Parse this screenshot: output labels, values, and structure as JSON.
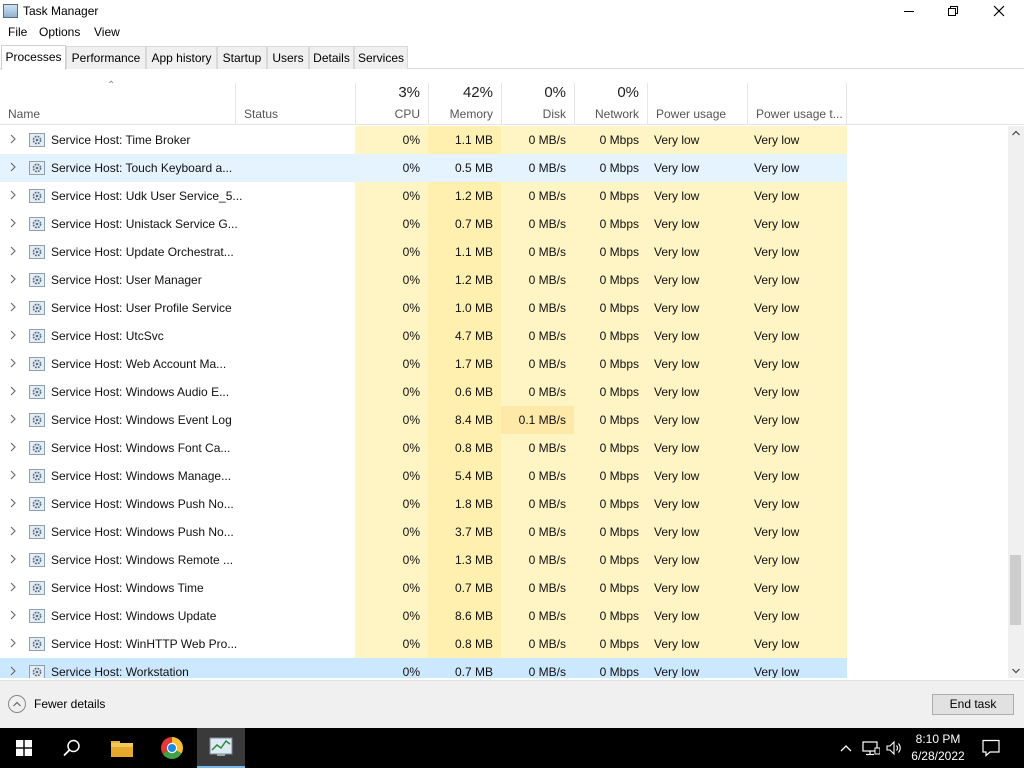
{
  "window": {
    "title": "Task Manager"
  },
  "menu": [
    "File",
    "Options",
    "View"
  ],
  "tabs": [
    "Processes",
    "Performance",
    "App history",
    "Startup",
    "Users",
    "Details",
    "Services"
  ],
  "columns": {
    "name": "Name",
    "status": "Status",
    "cpu": {
      "pct": "3%",
      "label": "CPU"
    },
    "memory": {
      "pct": "42%",
      "label": "Memory"
    },
    "disk": {
      "pct": "0%",
      "label": "Disk"
    },
    "network": {
      "pct": "0%",
      "label": "Network"
    },
    "power": "Power usage",
    "power_trend": "Power usage t..."
  },
  "processes": [
    {
      "name": "Service Host: Time Broker",
      "cpu": "0%",
      "memory": "1.1 MB",
      "disk": "0 MB/s",
      "network": "0 Mbps",
      "power": "Very low",
      "power_trend": "Very low"
    },
    {
      "name": "Service Host: Touch Keyboard a...",
      "cpu": "0%",
      "memory": "0.5 MB",
      "disk": "0 MB/s",
      "network": "0 Mbps",
      "power": "Very low",
      "power_trend": "Very low"
    },
    {
      "name": "Service Host: Udk User Service_5...",
      "cpu": "0%",
      "memory": "1.2 MB",
      "disk": "0 MB/s",
      "network": "0 Mbps",
      "power": "Very low",
      "power_trend": "Very low"
    },
    {
      "name": "Service Host: Unistack Service G...",
      "cpu": "0%",
      "memory": "0.7 MB",
      "disk": "0 MB/s",
      "network": "0 Mbps",
      "power": "Very low",
      "power_trend": "Very low"
    },
    {
      "name": "Service Host: Update Orchestrat...",
      "cpu": "0%",
      "memory": "1.1 MB",
      "disk": "0 MB/s",
      "network": "0 Mbps",
      "power": "Very low",
      "power_trend": "Very low"
    },
    {
      "name": "Service Host: User Manager",
      "cpu": "0%",
      "memory": "1.2 MB",
      "disk": "0 MB/s",
      "network": "0 Mbps",
      "power": "Very low",
      "power_trend": "Very low"
    },
    {
      "name": "Service Host: User Profile Service",
      "cpu": "0%",
      "memory": "1.0 MB",
      "disk": "0 MB/s",
      "network": "0 Mbps",
      "power": "Very low",
      "power_trend": "Very low"
    },
    {
      "name": "Service Host: UtcSvc",
      "cpu": "0%",
      "memory": "4.7 MB",
      "disk": "0 MB/s",
      "network": "0 Mbps",
      "power": "Very low",
      "power_trend": "Very low"
    },
    {
      "name": "Service Host: Web Account Ma...",
      "cpu": "0%",
      "memory": "1.7 MB",
      "disk": "0 MB/s",
      "network": "0 Mbps",
      "power": "Very low",
      "power_trend": "Very low"
    },
    {
      "name": "Service Host: Windows Audio E...",
      "cpu": "0%",
      "memory": "0.6 MB",
      "disk": "0 MB/s",
      "network": "0 Mbps",
      "power": "Very low",
      "power_trend": "Very low"
    },
    {
      "name": "Service Host: Windows Event Log",
      "cpu": "0%",
      "memory": "8.4 MB",
      "disk": "0.1 MB/s",
      "network": "0 Mbps",
      "power": "Very low",
      "power_trend": "Very low"
    },
    {
      "name": "Service Host: Windows Font Ca...",
      "cpu": "0%",
      "memory": "0.8 MB",
      "disk": "0 MB/s",
      "network": "0 Mbps",
      "power": "Very low",
      "power_trend": "Very low"
    },
    {
      "name": "Service Host: Windows Manage...",
      "cpu": "0%",
      "memory": "5.4 MB",
      "disk": "0 MB/s",
      "network": "0 Mbps",
      "power": "Very low",
      "power_trend": "Very low"
    },
    {
      "name": "Service Host: Windows Push No...",
      "cpu": "0%",
      "memory": "1.8 MB",
      "disk": "0 MB/s",
      "network": "0 Mbps",
      "power": "Very low",
      "power_trend": "Very low"
    },
    {
      "name": "Service Host: Windows Push No...",
      "cpu": "0%",
      "memory": "3.7 MB",
      "disk": "0 MB/s",
      "network": "0 Mbps",
      "power": "Very low",
      "power_trend": "Very low"
    },
    {
      "name": "Service Host: Windows Remote ...",
      "cpu": "0%",
      "memory": "1.3 MB",
      "disk": "0 MB/s",
      "network": "0 Mbps",
      "power": "Very low",
      "power_trend": "Very low"
    },
    {
      "name": "Service Host: Windows Time",
      "cpu": "0%",
      "memory": "0.7 MB",
      "disk": "0 MB/s",
      "network": "0 Mbps",
      "power": "Very low",
      "power_trend": "Very low"
    },
    {
      "name": "Service Host: Windows Update",
      "cpu": "0%",
      "memory": "8.6 MB",
      "disk": "0 MB/s",
      "network": "0 Mbps",
      "power": "Very low",
      "power_trend": "Very low"
    },
    {
      "name": "Service Host: WinHTTP Web Pro...",
      "cpu": "0%",
      "memory": "0.8 MB",
      "disk": "0 MB/s",
      "network": "0 Mbps",
      "power": "Very low",
      "power_trend": "Very low"
    },
    {
      "name": "Service Host: Workstation",
      "cpu": "0%",
      "memory": "0.7 MB",
      "disk": "0 MB/s",
      "network": "0 Mbps",
      "power": "Very low",
      "power_trend": "Very low"
    }
  ],
  "selected_row": 19,
  "hover_row": 1,
  "footer": {
    "fewer_details": "Fewer details",
    "end_task": "End task"
  },
  "taskbar": {
    "time": "8:10 PM",
    "date": "6/28/2022"
  },
  "colors": {
    "heat_light": "#fff4c4",
    "heat_mid": "#fff0b0",
    "selected": "#cce8ff",
    "hover": "#e5f3ff",
    "accent": "#0078d7"
  },
  "icons": {
    "window_controls": [
      "minimize-icon",
      "maximize-icon",
      "close-icon"
    ],
    "taskbar": [
      "windows-start-icon",
      "search-icon",
      "file-explorer-icon",
      "chrome-icon",
      "task-manager-icon"
    ],
    "tray": [
      "chevron-up-icon",
      "network-icon",
      "volume-icon",
      "notification-icon"
    ]
  }
}
